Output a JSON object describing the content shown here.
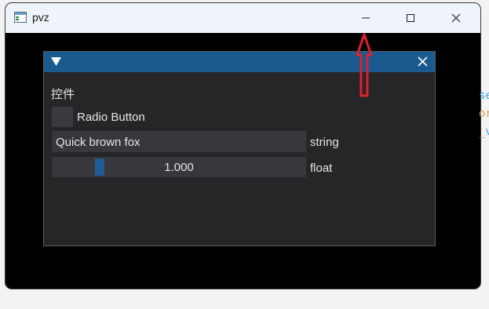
{
  "window": {
    "title": "pvz",
    "icon": "app-window-icon",
    "controls": [
      "minimize-icon",
      "maximize-icon",
      "close-icon"
    ]
  },
  "background_peek": {
    "lines": [
      "se",
      "or",
      "_v"
    ],
    "colors": [
      "#4a9fd8",
      "#d7a060",
      "#4a9fd8"
    ]
  },
  "panel": {
    "header_icon": "collapse-triangle-icon",
    "close_icon": "close-icon",
    "section_title": "控件",
    "radio_label": "Radio Button",
    "radio_checked": false,
    "text_input_value": "Quick brown fox",
    "text_input_label": "string",
    "slider_value_text": "1.000",
    "slider_fraction": 0.1,
    "slider_label": "float"
  },
  "colors": {
    "header": "#1a5a8f",
    "panel_bg": "#262628",
    "frame_bg": "#38383c",
    "slider_grab": "#1f5d96",
    "annotation_arrow": "#e0202a"
  }
}
